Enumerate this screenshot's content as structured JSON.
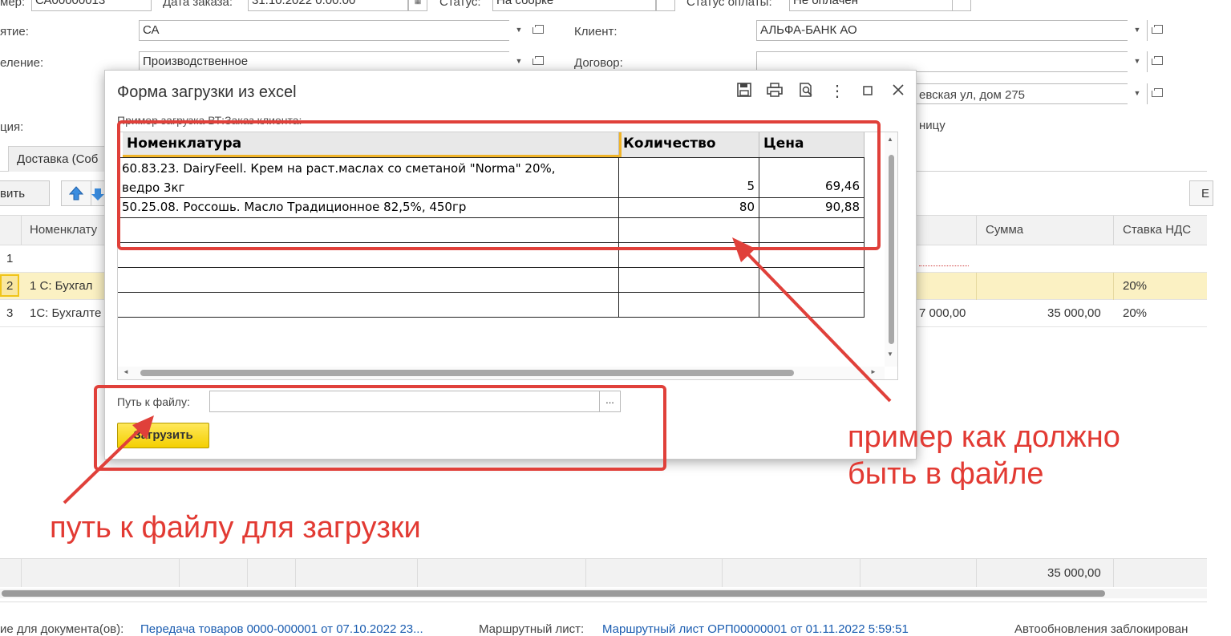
{
  "form": {
    "number_label": "мер:",
    "number_value": "СА00000013",
    "date_label": "Дата заказа:",
    "date_value": "31.10.2022  0:00:00",
    "status_label": "Статус:",
    "status_value": "На сборке",
    "pay_status_label": "Статус оплаты:",
    "pay_status_value": "Не оплачен",
    "org_label": "ятие:",
    "org_value": "СА",
    "client_label": "Клиент:",
    "client_value": "АЛЬФА-БАНК АО",
    "dept_label": "еление:",
    "dept_value": "Производственное",
    "contract_label": "Договор:",
    "contract_value": "",
    "address_value": "евская ул, дом 275",
    "ship_label": "ция:",
    "ship_right_text": "ницу"
  },
  "tabs": {
    "delivery": "Доставка (Соб"
  },
  "toolbar": {
    "add_label": "вить",
    "right_btn": "Е"
  },
  "grid": {
    "col_nomen": "Номенклату",
    "col_sum": "Сумма",
    "col_vat": "Ставка НДС",
    "rows": [
      {
        "n": "1",
        "name": "",
        "price": "",
        "sum": "",
        "vat": ""
      },
      {
        "n": "2",
        "name": "1 С:  Бухгал",
        "price": "",
        "sum": "",
        "vat": "20%"
      },
      {
        "n": "3",
        "name": "1С: Бухгалте",
        "price": "7 000,00",
        "sum": "35 000,00",
        "vat": "20%"
      }
    ],
    "total": "35 000,00"
  },
  "footer": {
    "basis_label": "ие для документа(ов):",
    "basis_link": "Передача товаров 0000-000001 от 07.10.2022 23...",
    "route_label": "Маршрутный лист:",
    "route_link": "Маршрутный лист ОРП00000001 от 01.11.2022 5:59:51",
    "autoupdate": "Автообновления заблокирован"
  },
  "modal": {
    "title": "Форма загрузки из excel",
    "sample_caption": "Пример загрузка ВТ:Заказ клиента:",
    "headers": [
      "Номенклатура",
      "Количество",
      "Цена"
    ],
    "rows": [
      {
        "name1": "60.83.23. DairyFeell. Крем на раст.маслах со сметаной \"Norma\" 20%,",
        "name2": "ведро 3кг",
        "qty": "5",
        "price": "69,46"
      },
      {
        "name1": "50.25.08. Россошь. Масло Традиционное 82,5%, 450гр",
        "name2": "",
        "qty": "80",
        "price": "90,88"
      }
    ],
    "path_label": "Путь к файлу:",
    "path_value": "",
    "browse_label": "...",
    "load_button": "Загрузить"
  },
  "annotations": {
    "sample_note_line1": "пример как должно",
    "sample_note_line2": "быть в файле",
    "path_note": "путь к файлу для загрузки"
  },
  "colors": {
    "annotation_red": "#e23a33",
    "selected_row": "#fbf1c3",
    "load_button_yellow": "#f7d500",
    "link_blue": "#1a5cb0"
  }
}
